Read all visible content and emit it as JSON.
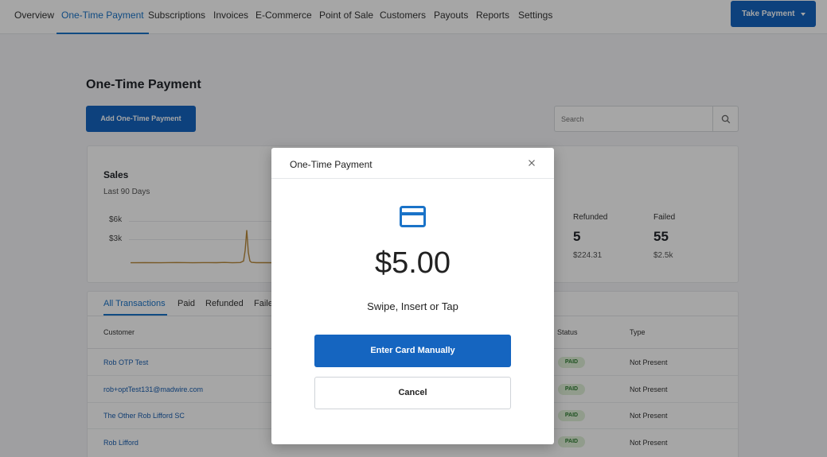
{
  "nav": {
    "items": [
      "Overview",
      "One-Time Payment",
      "Subscriptions",
      "Invoices",
      "E-Commerce",
      "Point of Sale",
      "Customers",
      "Payouts",
      "Reports",
      "Settings"
    ],
    "active": "One-Time Payment",
    "take_payment_label": "Take Payment"
  },
  "page": {
    "title": "One-Time Payment",
    "add_button_label": "Add One-Time Payment",
    "search_placeholder": "Search"
  },
  "sales": {
    "title": "Sales",
    "subtitle": "Last 90 Days",
    "y_ticks": [
      "$6k",
      "$3k"
    ],
    "stats": [
      {
        "label": "Refunded",
        "count": "5",
        "amount": "$224.31"
      },
      {
        "label": "Failed",
        "count": "55",
        "amount": "$2.5k"
      }
    ]
  },
  "chart_data": {
    "type": "line",
    "title": "",
    "xlabel": "",
    "ylabel": "",
    "ylim": [
      0,
      7000
    ],
    "y_ticks": [
      3000,
      6000
    ],
    "x": [
      1,
      10,
      20,
      30,
      40,
      50,
      55,
      60,
      65,
      70,
      72,
      73,
      74,
      75,
      76,
      77,
      80,
      85,
      90
    ],
    "series": [
      {
        "values": [
          50,
          60,
          40,
          80,
          50,
          70,
          60,
          90,
          50,
          80,
          300,
          1800,
          4700,
          1500,
          300,
          100,
          60,
          70,
          50
        ]
      }
    ],
    "color": "#b8893a"
  },
  "transactions": {
    "tabs": [
      "All Transactions",
      "Paid",
      "Refunded",
      "Faile"
    ],
    "active_tab": "All Transactions",
    "columns": {
      "customer": "Customer",
      "status": "Status",
      "type": "Type"
    },
    "rows": [
      {
        "customer": "Rob OTP Test",
        "status": "PAID",
        "type": "Not Present"
      },
      {
        "customer": "rob+optTest131@madwire.com",
        "status": "PAID",
        "type": "Not Present"
      },
      {
        "customer": "The Other Rob Lifford SC",
        "status": "PAID",
        "type": "Not Present"
      },
      {
        "customer": "Rob Lifford",
        "status": "PAID",
        "type": "Not Present"
      }
    ]
  },
  "modal": {
    "title": "One-Time Payment",
    "icon": "credit-card-icon",
    "amount": "$5.00",
    "instruction": "Swipe, Insert or Tap",
    "primary_label": "Enter Card Manually",
    "cancel_label": "Cancel"
  },
  "colors": {
    "brand_blue": "#1565c0",
    "link_blue": "#1a73c8",
    "paid_badge_bg": "#dff0d8",
    "paid_badge_text": "#2f7d32"
  }
}
